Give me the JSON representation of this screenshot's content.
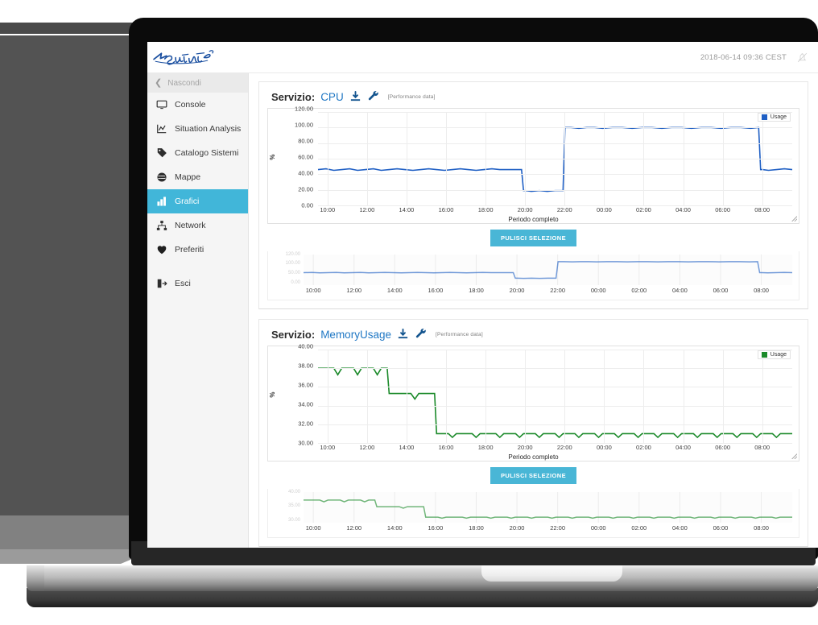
{
  "header": {
    "logo_alt": "SentiNet",
    "datetime": "2018-06-14 09:36 CEST",
    "bell_icon": "bell-muted-icon"
  },
  "sidebar": {
    "hide_label": "Nascondi",
    "items": [
      {
        "label": "Console",
        "icon": "monitor-icon",
        "active": false
      },
      {
        "label": "Situation Analysis",
        "icon": "chart-line-icon",
        "active": false
      },
      {
        "label": "Catalogo Sistemi",
        "icon": "tag-icon",
        "active": false
      },
      {
        "label": "Mappe",
        "icon": "globe-icon",
        "active": false
      },
      {
        "label": "Grafici",
        "icon": "bar-chart-icon",
        "active": true
      },
      {
        "label": "Network",
        "icon": "sitemap-icon",
        "active": false
      },
      {
        "label": "Preferiti",
        "icon": "heart-icon",
        "active": false
      }
    ],
    "logout": {
      "label": "Esci",
      "icon": "logout-icon"
    },
    "active_color": "#41b6d9"
  },
  "panels": [
    {
      "service_label": "Servizio:",
      "service_name": "CPU",
      "download_icon": "download-icon",
      "wrench_icon": "wrench-icon",
      "perf_tag": "[Performance data]",
      "clear_button": "PULISCI SELEZIONE",
      "accent": "#1f5fc4"
    },
    {
      "service_label": "Servizio:",
      "service_name": "MemoryUsage",
      "download_icon": "download-icon",
      "wrench_icon": "wrench-icon",
      "perf_tag": "[Performance data]",
      "clear_button": "PULISCI SELEZIONE",
      "accent": "#1b8a2a"
    }
  ],
  "chart_data": [
    {
      "type": "line",
      "title": "CPU",
      "xlabel": "Periodo completo",
      "ylabel": "%",
      "ylim": [
        0,
        120
      ],
      "yticks": [
        0.0,
        20.0,
        40.0,
        60.0,
        80.0,
        100.0,
        120.0
      ],
      "ytick_labels": [
        "0.00",
        "20.00",
        "40.00",
        "60.00",
        "80.00",
        "100.00",
        "120.00"
      ],
      "xticks": [
        "10:00",
        "12:00",
        "14:00",
        "16:00",
        "18:00",
        "20:00",
        "22:00",
        "00:00",
        "02:00",
        "04:00",
        "06:00",
        "08:00"
      ],
      "grid": true,
      "legend": {
        "position": "top-right",
        "entries": [
          {
            "name": "Usage",
            "color": "#1f5fc4"
          }
        ]
      },
      "series": [
        {
          "name": "Usage",
          "color": "#1f5fc4",
          "x": [
            9.6,
            10,
            10.4,
            10.8,
            11.2,
            11.6,
            12,
            12.4,
            12.8,
            13.2,
            13.6,
            14,
            14.4,
            14.8,
            15.2,
            15.6,
            16,
            16.4,
            16.8,
            17.2,
            17.6,
            18,
            18.4,
            18.8,
            19.2,
            19.6,
            19.9,
            20.0,
            20.1,
            20.4,
            20.8,
            21.2,
            21.6,
            21.9,
            22.0,
            22.1,
            22.4,
            22.8,
            23.2,
            23.6,
            24,
            24.5,
            25,
            25.5,
            26,
            26.5,
            27,
            27.5,
            28,
            28.5,
            29,
            29.5,
            30,
            30.5,
            31,
            31.5,
            31.9,
            32.0,
            32.1,
            32.4,
            32.8,
            33.2,
            33.6
          ],
          "values": [
            46,
            47,
            45,
            46,
            47,
            45,
            46,
            47,
            45,
            46,
            47,
            46,
            45,
            46,
            47,
            46,
            45,
            46,
            47,
            46,
            45,
            46,
            47,
            46,
            46,
            46,
            46,
            19,
            19,
            18,
            19,
            18,
            19,
            19,
            19,
            100,
            100,
            99,
            100,
            100,
            99,
            100,
            100,
            99,
            100,
            100,
            99,
            100,
            100,
            99,
            100,
            100,
            99,
            100,
            100,
            99,
            100,
            46,
            46,
            45,
            46,
            47,
            46
          ]
        }
      ],
      "navigator": {
        "visible": true,
        "ytick_labels": [
          "120.00",
          "100.00",
          "50.00",
          "0.00"
        ]
      }
    },
    {
      "type": "line",
      "title": "MemoryUsage",
      "xlabel": "Periodo completo",
      "ylabel": "%",
      "ylim": [
        30,
        40
      ],
      "yticks": [
        30.0,
        32.0,
        34.0,
        36.0,
        38.0,
        40.0
      ],
      "ytick_labels": [
        "30.00",
        "32.00",
        "34.00",
        "36.00",
        "38.00",
        "40.00"
      ],
      "xticks": [
        "10:00",
        "12:00",
        "14:00",
        "16:00",
        "18:00",
        "20:00",
        "22:00",
        "00:00",
        "02:00",
        "04:00",
        "06:00",
        "08:00"
      ],
      "grid": true,
      "legend": {
        "position": "top-right",
        "entries": [
          {
            "name": "Usage",
            "color": "#1b8a2a"
          }
        ]
      },
      "series": [
        {
          "name": "Usage",
          "color": "#1b8a2a",
          "x": [
            9.6,
            10.4,
            10.6,
            10.8,
            11.4,
            11.6,
            11.8,
            12.4,
            12.6,
            12.8,
            13.1,
            13.2,
            13.3,
            13.4,
            14.3,
            14.5,
            14.7,
            15.4,
            15.5,
            15.6,
            15.7,
            16.2,
            16.4,
            16.6,
            17.4,
            17.6,
            17.8,
            18.6,
            18.8,
            19.0,
            19.6,
            19.8,
            20.0,
            20.6,
            20.8,
            21.0,
            21.6,
            21.8,
            22.0,
            22.6,
            22.8,
            23.0,
            23.6,
            23.8,
            24.0,
            24.6,
            24.8,
            25.0,
            25.6,
            25.8,
            26.0,
            26.6,
            26.8,
            27.0,
            27.6,
            27.8,
            28.0,
            28.6,
            28.8,
            29.0,
            29.6,
            29.8,
            30.0,
            30.6,
            30.8,
            31.0,
            31.6,
            31.8,
            32.0,
            32.6,
            32.8,
            33.0,
            33.6
          ],
          "values": [
            38,
            38,
            37.3,
            38,
            38,
            37.3,
            38,
            38,
            37.3,
            38,
            38,
            35.3,
            35.3,
            35.3,
            35.3,
            34.7,
            35.3,
            35.3,
            35.3,
            31,
            31,
            31,
            30.6,
            31,
            31,
            30.6,
            31,
            31,
            30.6,
            31,
            31,
            30.6,
            31,
            31,
            30.6,
            31,
            31,
            30.6,
            31,
            31,
            30.6,
            31,
            31,
            30.6,
            31,
            31,
            30.6,
            31,
            31,
            30.6,
            31,
            31,
            30.6,
            31,
            31,
            30.6,
            31,
            31,
            30.6,
            31,
            31,
            30.6,
            31,
            31,
            30.6,
            31,
            31,
            30.6,
            31,
            31,
            30.6,
            31,
            31
          ]
        }
      ],
      "navigator": {
        "visible": true,
        "ytick_labels": [
          "40.00",
          "35.00",
          "30.00"
        ]
      }
    }
  ]
}
